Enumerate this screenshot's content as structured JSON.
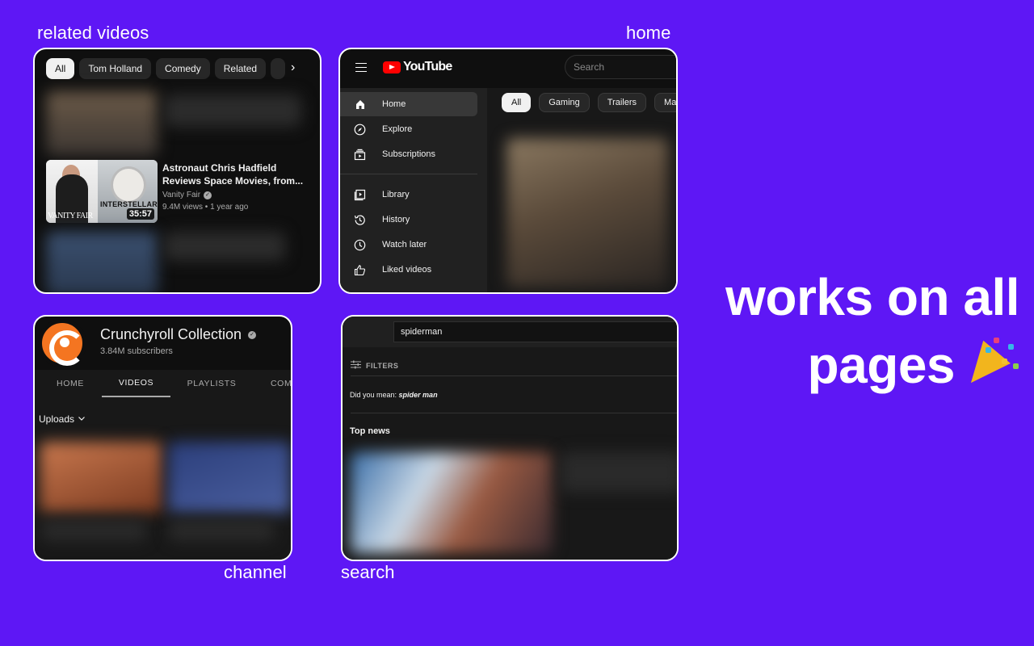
{
  "captions": {
    "related": "related videos",
    "home": "home",
    "channel": "channel",
    "search": "search"
  },
  "headline": {
    "line1": "works on all",
    "line2": "pages",
    "emoji": "party-popper"
  },
  "related": {
    "chips": [
      "All",
      "Tom Holland",
      "Comedy",
      "Related"
    ],
    "video": {
      "title_line1": "Astronaut Chris Hadfield",
      "title_line2": "Reviews Space Movies, from...",
      "channel": "Vanity Fair",
      "meta": "9.4M views • 1 year ago",
      "duration": "35:57",
      "thumb_left_text": "VANITY FAIR",
      "thumb_right_text": "INTERSTELLAR"
    }
  },
  "home": {
    "logo_text": "YouTube",
    "search_placeholder": "Search",
    "sidebar": [
      {
        "label": "Home",
        "icon": "home-icon"
      },
      {
        "label": "Explore",
        "icon": "compass-icon"
      },
      {
        "label": "Subscriptions",
        "icon": "subscriptions-icon"
      },
      {
        "label": "Library",
        "icon": "library-icon"
      },
      {
        "label": "History",
        "icon": "history-icon"
      },
      {
        "label": "Watch later",
        "icon": "clock-icon"
      },
      {
        "label": "Liked videos",
        "icon": "thumbs-up-icon"
      }
    ],
    "chips": [
      "All",
      "Gaming",
      "Trailers",
      "Marvel"
    ]
  },
  "channel": {
    "name": "Crunchyroll Collection",
    "subscribers": "3.84M subscribers",
    "tabs": [
      "HOME",
      "VIDEOS",
      "PLAYLISTS",
      "COMMUNITY"
    ],
    "uploads_label": "Uploads"
  },
  "search": {
    "query": "spiderman",
    "filters_label": "FILTERS",
    "did_you_mean_prefix": "Did you mean:",
    "did_you_mean_term": "spider man",
    "top_news": "Top news"
  },
  "colors": {
    "background": "#5e17f5",
    "panel": "#0f0f0f",
    "accent": "#ff0000"
  }
}
